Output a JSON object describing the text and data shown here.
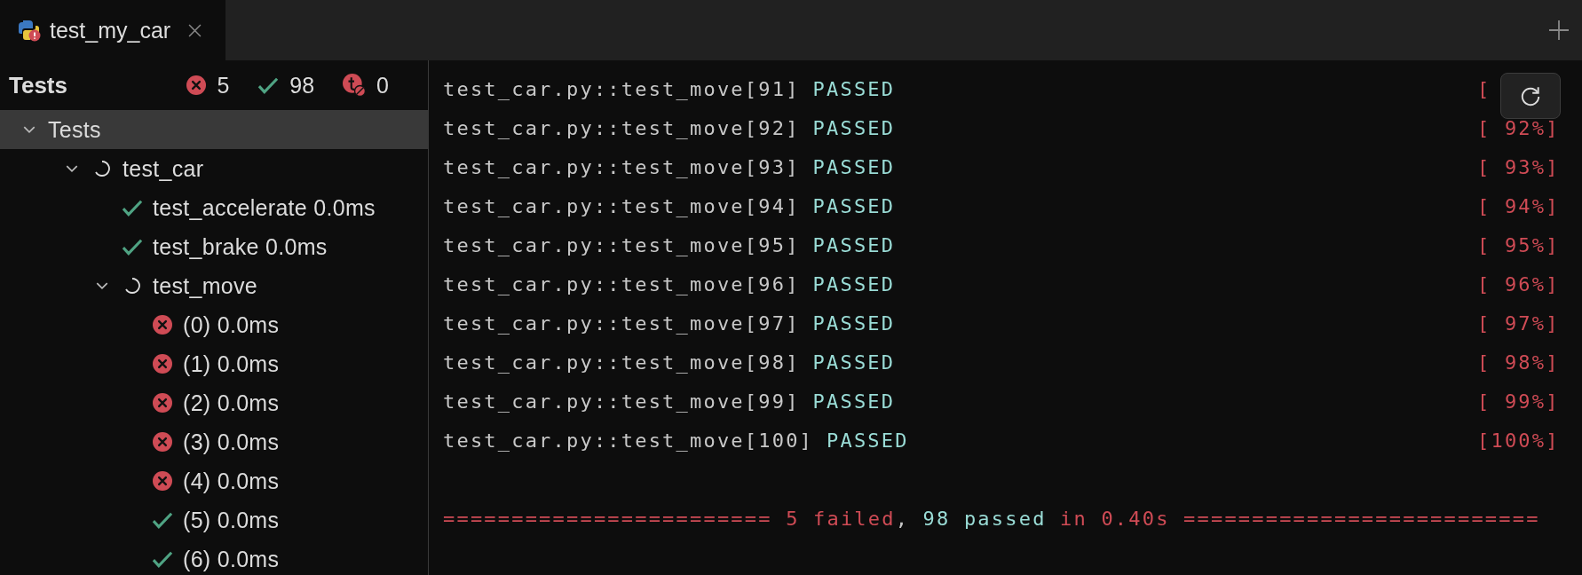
{
  "tabs": [
    {
      "title": "test_my_car",
      "selected": true
    }
  ],
  "sidebar": {
    "title": "Tests",
    "counts": [
      {
        "kind": "failed",
        "count": "5"
      },
      {
        "kind": "passed",
        "count": "98"
      },
      {
        "kind": "ignored",
        "count": "0"
      }
    ],
    "tree": [
      {
        "label": "Tests",
        "expanded": true,
        "selected": true,
        "children": [
          {
            "label": "test_car",
            "kind": "running",
            "expanded": true,
            "selected": false,
            "children": [
              {
                "label": "test_accelerate 0.0ms",
                "kind": "passed",
                "selected": false
              },
              {
                "label": "test_brake 0.0ms",
                "kind": "passed",
                "selected": false
              },
              {
                "label": "test_move",
                "kind": "running",
                "expanded": true,
                "selected": false,
                "children": [
                  {
                    "label": "(0) 0.0ms",
                    "kind": "failed",
                    "selected": false
                  },
                  {
                    "label": "(1) 0.0ms",
                    "kind": "failed",
                    "selected": false
                  },
                  {
                    "label": "(2) 0.0ms",
                    "kind": "failed",
                    "selected": false
                  },
                  {
                    "label": "(3) 0.0ms",
                    "kind": "failed",
                    "selected": false
                  },
                  {
                    "label": "(4) 0.0ms",
                    "kind": "failed",
                    "selected": false
                  },
                  {
                    "label": "(5) 0.0ms",
                    "kind": "passed",
                    "selected": false
                  },
                  {
                    "label": "(6) 0.0ms",
                    "kind": "passed",
                    "selected": false
                  }
                ]
              }
            ]
          }
        ]
      }
    ]
  },
  "console": {
    "lines": [
      {
        "test": "test_car.py::test_move[91]",
        "result": "PASSED",
        "kind": "passed",
        "percent": "["
      },
      {
        "test": "test_car.py::test_move[92]",
        "result": "PASSED",
        "kind": "passed",
        "percent": "[ 92%]"
      },
      {
        "test": "test_car.py::test_move[93]",
        "result": "PASSED",
        "kind": "passed",
        "percent": "[ 93%]"
      },
      {
        "test": "test_car.py::test_move[94]",
        "result": "PASSED",
        "kind": "passed",
        "percent": "[ 94%]"
      },
      {
        "test": "test_car.py::test_move[95]",
        "result": "PASSED",
        "kind": "passed",
        "percent": "[ 95%]"
      },
      {
        "test": "test_car.py::test_move[96]",
        "result": "PASSED",
        "kind": "passed",
        "percent": "[ 96%]"
      },
      {
        "test": "test_car.py::test_move[97]",
        "result": "PASSED",
        "kind": "passed",
        "percent": "[ 97%]"
      },
      {
        "test": "test_car.py::test_move[98]",
        "result": "PASSED",
        "kind": "passed",
        "percent": "[ 98%]"
      },
      {
        "test": "test_car.py::test_move[99]",
        "result": "PASSED",
        "kind": "passed",
        "percent": "[ 99%]"
      },
      {
        "test": "test_car.py::test_move[100]",
        "result": "PASSED",
        "kind": "passed",
        "percent": "[100%]"
      }
    ],
    "summary": [
      {
        "kind": "failed",
        "text": "======================== 5 failed"
      },
      {
        "kind": "plain",
        "text": ", "
      },
      {
        "kind": "passed",
        "text": "98 passed"
      },
      {
        "kind": "failed",
        "text": " in 0.40s =========================="
      }
    ]
  }
}
